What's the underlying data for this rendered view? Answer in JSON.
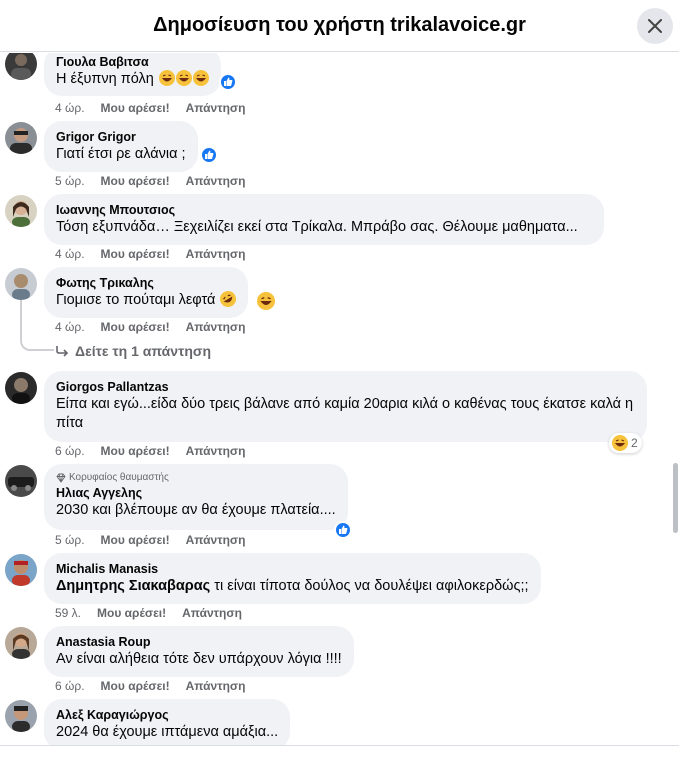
{
  "header": {
    "title": "Δημοσίευση του χρήστη trikalavoice.gr"
  },
  "labels": {
    "like": "Μου αρέσει!",
    "reply": "Απάντηση",
    "view_replies": "Δείτε τη 1 απάντηση",
    "top_fan": "Κορυφαίος θαυμαστής"
  },
  "comments": [
    {
      "name": "Γιουλα Βαβιτσα",
      "text": "Η έξυπνη πόλη",
      "time": "4 ώρ."
    },
    {
      "name": "Grigor Grigor",
      "text": "Γιατί έτσι ρε αλάνια ;",
      "time": "5 ώρ."
    },
    {
      "name": "Ιωαννης Μπουτσιος",
      "text": "Τόση εξυπνάδα… Ξεχειλίζει εκεί στα Τρίκαλα. Μπράβο σας. Θέλουμε μαθηματα...",
      "time": "4 ώρ."
    },
    {
      "name": "Φωτης Τρικαλης",
      "text": "Γιομισε το πούταμι λεφτά",
      "time": "4 ώρ."
    },
    {
      "name": "Giorgos Pallantzas",
      "text": "Είπα και εγώ...είδα δύο τρεις βάλανε από καμία 20αρια κιλά ο καθένας τους έκατσε καλά η πίτα",
      "time": "6 ώρ.",
      "reaction_count": "2"
    },
    {
      "name": "Ηλιας Αγγελης",
      "text": "2030 και βλέπουμε αν θα έχουμε πλατεία....",
      "time": "5 ώρ."
    },
    {
      "name": "Michalis Manasis",
      "mention": "Δημητρης Σιακαβαρας",
      "text": " τι είναι τίποτα δούλος να δουλέψει αφιλοκερδώς;;",
      "time": "59 λ."
    },
    {
      "name": "Anastasia Roup",
      "text": "Αν είναι αλήθεια τότε δεν υπάρχουν λόγια !!!!",
      "time": "6 ώρ."
    },
    {
      "name": "Αλεξ Καραγιώργος",
      "text": "2024 θα έχουμε ιπτάμενα αμάξια...",
      "time": ""
    }
  ],
  "colors": {
    "like_blue": "#1877f2",
    "bubble_bg": "#f0f2f5",
    "meta_gray": "#65676b"
  }
}
